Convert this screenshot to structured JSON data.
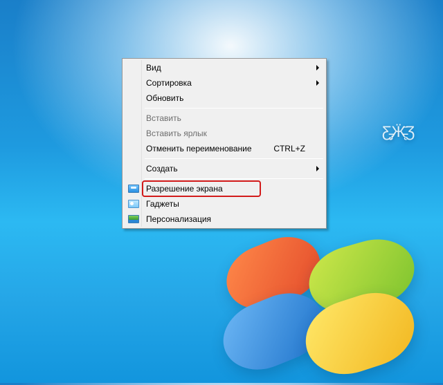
{
  "context_menu": {
    "items": [
      {
        "label": "Вид",
        "submenu": true
      },
      {
        "label": "Сортировка",
        "submenu": true
      },
      {
        "label": "Обновить"
      },
      {
        "sep": true
      },
      {
        "label": "Вставить",
        "disabled": true
      },
      {
        "label": "Вставить ярлык",
        "disabled": true
      },
      {
        "label": "Отменить переименование",
        "shortcut": "CTRL+Z"
      },
      {
        "sep": true
      },
      {
        "label": "Создать",
        "submenu": true
      },
      {
        "sep": true
      },
      {
        "label": "Разрешение экрана",
        "icon": "res",
        "highlighted": true
      },
      {
        "label": "Гаджеты",
        "icon": "gad"
      },
      {
        "label": "Персонализация",
        "icon": "per"
      }
    ]
  }
}
